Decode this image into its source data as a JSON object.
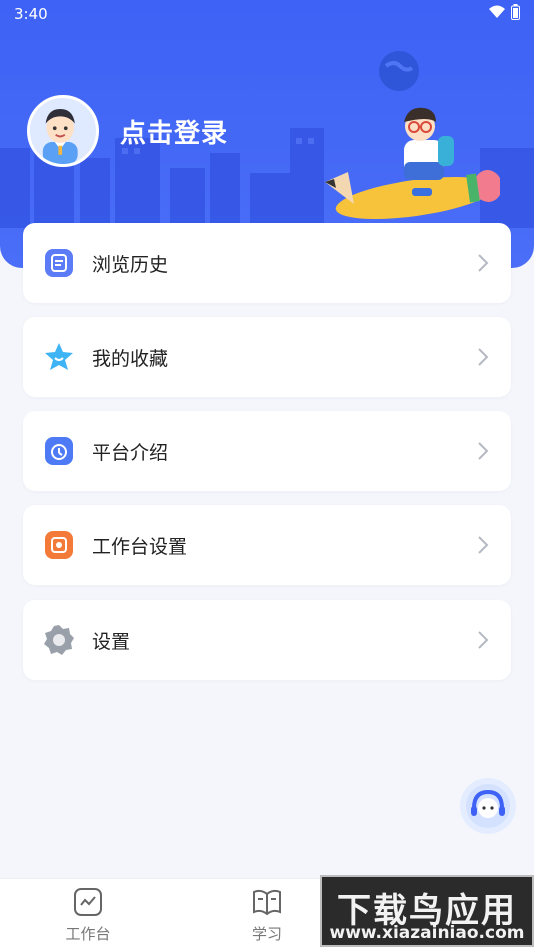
{
  "status_bar": {
    "time": "3:40"
  },
  "profile": {
    "login_label": "点击登录"
  },
  "menu": [
    {
      "label": "浏览历史",
      "icon": "history-icon",
      "color": "#5b7cf6"
    },
    {
      "label": "我的收藏",
      "icon": "star-icon",
      "color": "#3fb4f4"
    },
    {
      "label": "平台介绍",
      "icon": "info-icon",
      "color": "#4f7af5"
    },
    {
      "label": "工作台设置",
      "icon": "workbench-settings-icon",
      "color": "#f47a3a"
    },
    {
      "label": "设置",
      "icon": "gear-icon",
      "color": "#9aa0aa"
    }
  ],
  "tabbar": {
    "tabs": [
      {
        "label": "工作台",
        "icon": "workbench-icon"
      },
      {
        "label": "学习",
        "icon": "book-icon"
      }
    ]
  },
  "watermark": {
    "main": "下载鸟应用",
    "sub": "www.xiazainiao.com"
  },
  "colors": {
    "header": "#4466f6",
    "background": "#f4f6fb"
  }
}
